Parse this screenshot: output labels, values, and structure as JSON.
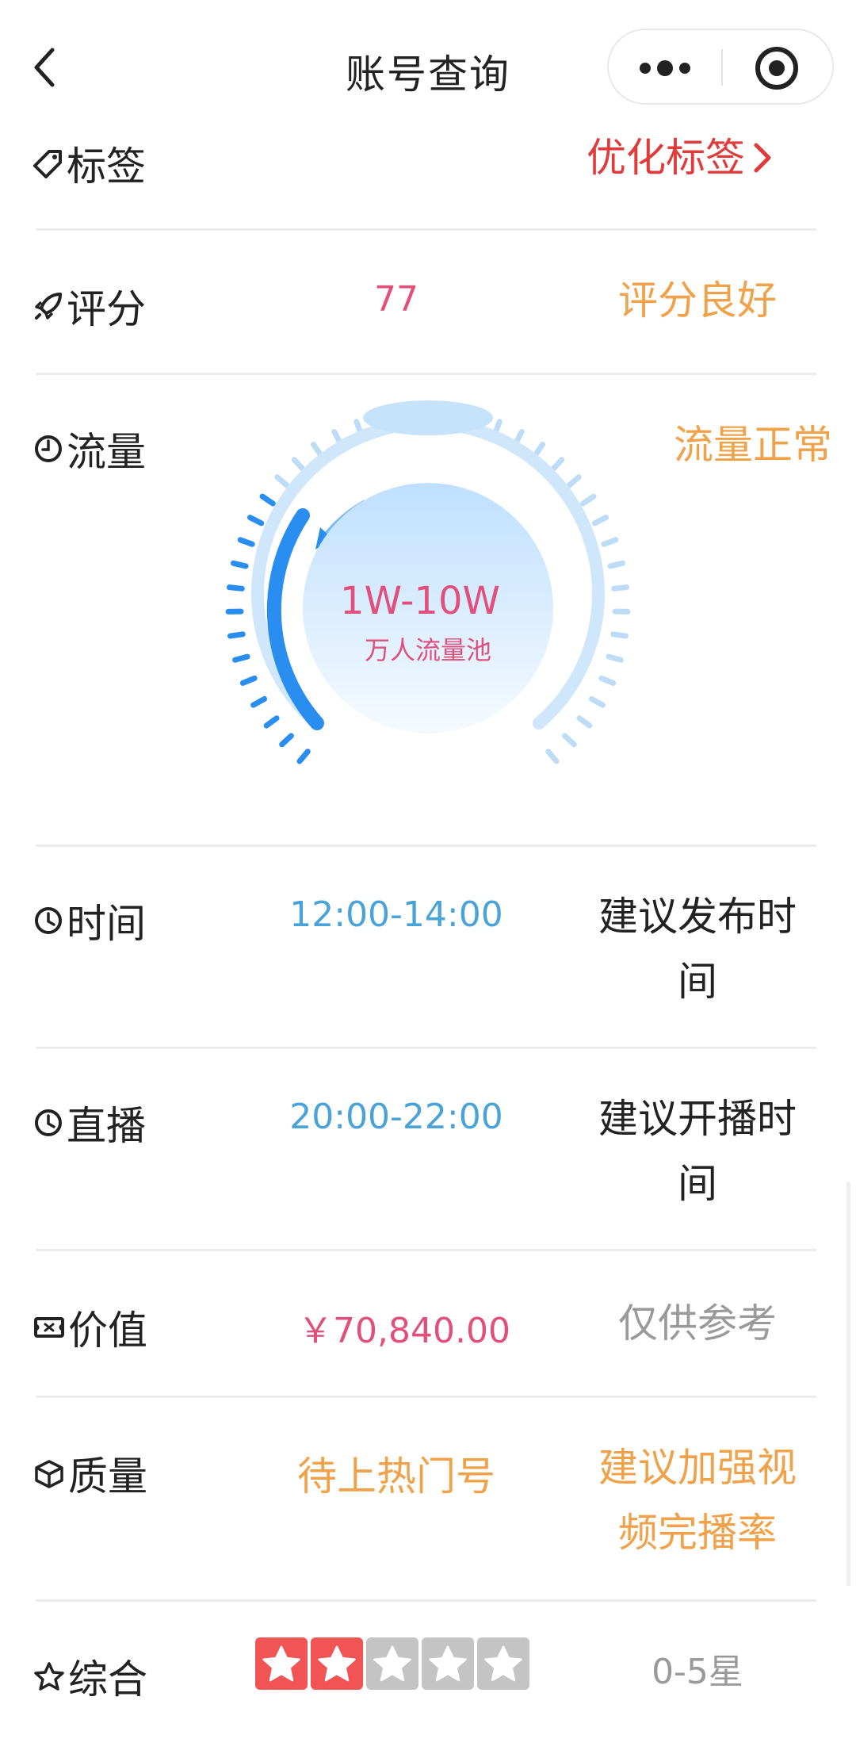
{
  "nav": {
    "title": "账号查询"
  },
  "rows": {
    "tag": {
      "label": "标签",
      "right": "优化标签"
    },
    "score": {
      "label": "评分",
      "value": "77",
      "right": "评分良好"
    },
    "traffic": {
      "label": "流量",
      "right": "流量正常",
      "gauge_value": "1W-10W",
      "gauge_caption": "万人流量池"
    },
    "time": {
      "label": "时间",
      "value": "12:00-14:00",
      "right_l1": "建议发布时",
      "right_l2": "间"
    },
    "live": {
      "label": "直播",
      "value": "20:00-22:00",
      "right_l1": "建议开播时",
      "right_l2": "间"
    },
    "worth": {
      "label": "价值",
      "value": "￥70,840.00",
      "right": "仅供参考"
    },
    "quality": {
      "label": "质量",
      "value": "待上热门号",
      "right_l1": "建议加强视",
      "right_l2": "频完播率"
    },
    "overall": {
      "label": "综合",
      "rating": 2,
      "max": 5,
      "right": "0-5星"
    }
  },
  "colors": {
    "red": "#e03a3a",
    "orange": "#f0a24b",
    "pink": "#e0507a",
    "blue": "#4aa3d8",
    "gray": "#9a9a9a",
    "star_active": "#f05454",
    "star_inactive": "#c4c4c4"
  },
  "icons": [
    "chevron-left-icon",
    "more-dots-icon",
    "target-icon",
    "tag-icon",
    "rocket-icon",
    "gauge-icon",
    "clock-icon",
    "ticket-icon",
    "box-icon",
    "star-icon"
  ]
}
